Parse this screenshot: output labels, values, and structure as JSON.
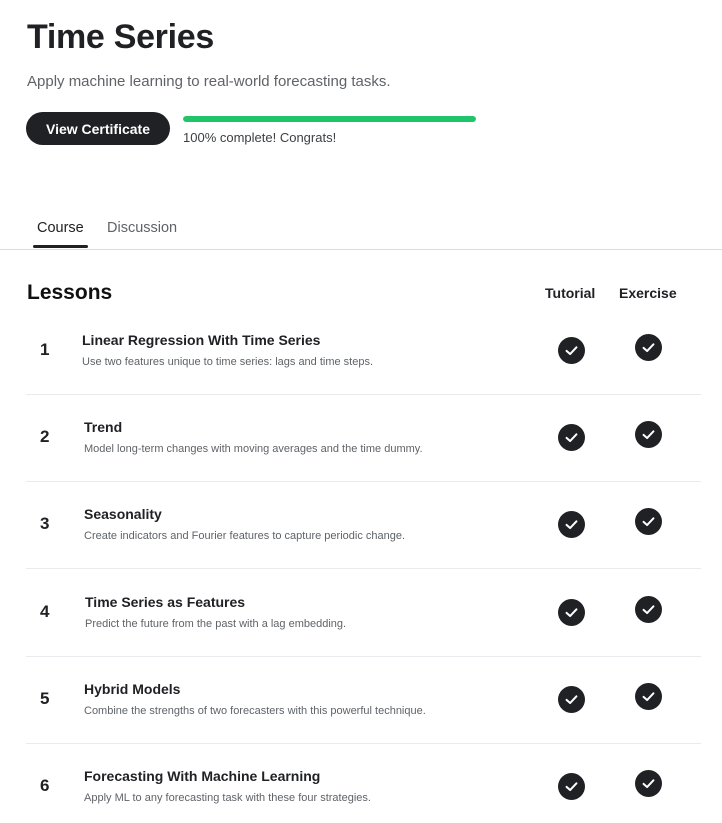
{
  "course": {
    "title": "Time Series",
    "subtitle": "Apply machine learning to real-world forecasting tasks.",
    "certificate_button": "View Certificate",
    "progress_percent": 100,
    "progress_text": "100% complete! Congrats!",
    "accent_color": "#20c56b"
  },
  "tabs": [
    {
      "label": "Course",
      "active": true
    },
    {
      "label": "Discussion",
      "active": false
    }
  ],
  "lessons_section": {
    "heading": "Lessons",
    "columns": [
      "Tutorial",
      "Exercise"
    ]
  },
  "lessons": [
    {
      "number": "1",
      "title": "Linear Regression With Time Series",
      "description": "Use two features unique to time series: lags and time steps.",
      "tutorial_done": true,
      "exercise_done": true,
      "icon": "check-circle-icon"
    },
    {
      "number": "2",
      "title": "Trend",
      "description": "Model long-term changes with moving averages and the time dummy.",
      "tutorial_done": true,
      "exercise_done": true,
      "icon": "check-circle-icon"
    },
    {
      "number": "3",
      "title": "Seasonality",
      "description": "Create indicators and Fourier features to capture periodic change.",
      "tutorial_done": true,
      "exercise_done": true,
      "icon": "check-circle-icon"
    },
    {
      "number": "4",
      "title": "Time Series as Features",
      "description": "Predict the future from the past with a lag embedding.",
      "tutorial_done": true,
      "exercise_done": true,
      "icon": "check-circle-icon"
    },
    {
      "number": "5",
      "title": "Hybrid Models",
      "description": "Combine the strengths of two forecasters with this powerful technique.",
      "tutorial_done": true,
      "exercise_done": true,
      "icon": "check-circle-icon"
    },
    {
      "number": "6",
      "title": "Forecasting With Machine Learning",
      "description": "Apply ML to any forecasting task with these four strategies.",
      "tutorial_done": true,
      "exercise_done": true,
      "icon": "check-circle-icon"
    }
  ]
}
